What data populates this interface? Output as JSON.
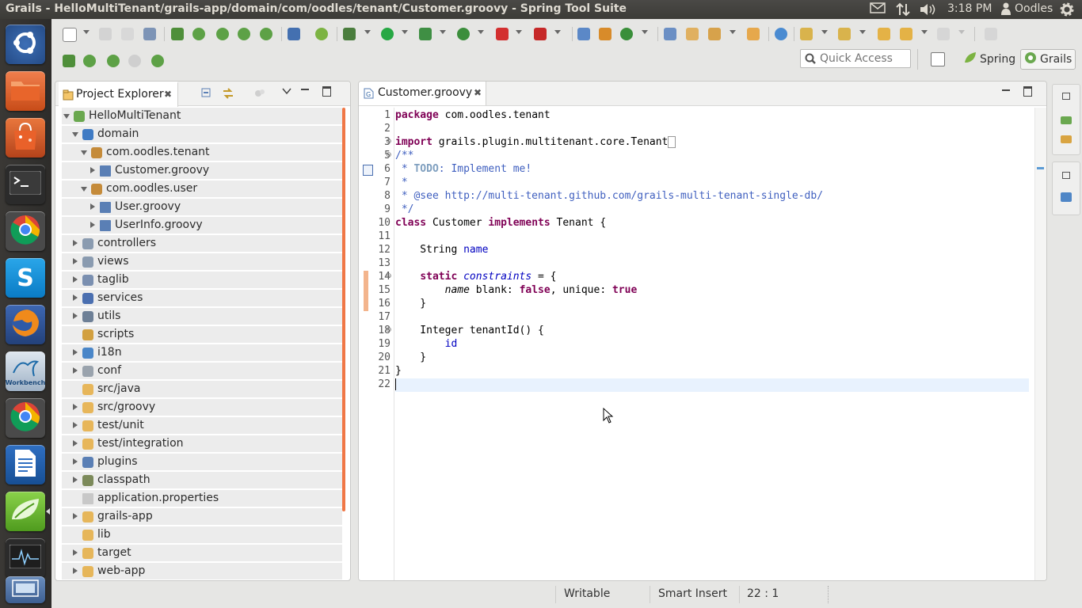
{
  "topbar": {
    "window_title": "Grails - HelloMultiTenant/grails-app/domain/com/oodles/tenant/Customer.groovy - Spring Tool Suite",
    "time": "3:18 PM",
    "user": "Oodles"
  },
  "launcher": {
    "items": [
      {
        "name": "Dash Home",
        "icon": "ubuntu-logo-icon"
      },
      {
        "name": "Files",
        "icon": "folder-icon"
      },
      {
        "name": "Ubuntu Software Center",
        "icon": "shopping-bag-icon"
      },
      {
        "name": "Terminal",
        "icon": "terminal-icon"
      },
      {
        "name": "Google Chrome",
        "icon": "chrome-icon"
      },
      {
        "name": "Skype",
        "icon": "skype-icon",
        "letter": "S"
      },
      {
        "name": "Firefox",
        "icon": "firefox-icon"
      },
      {
        "name": "MySQL Workbench",
        "icon": "mysql-workbench-icon",
        "label": "Workbench"
      },
      {
        "name": "Google Chrome",
        "icon": "chrome-icon"
      },
      {
        "name": "LibreOffice Writer",
        "icon": "writer-icon"
      },
      {
        "name": "Spring Tool Suite",
        "icon": "spring-leaf-icon"
      },
      {
        "name": "System Monitor",
        "icon": "system-monitor-icon"
      },
      {
        "name": "Workspace Switcher",
        "icon": "workspace-icon"
      }
    ]
  },
  "toolbar": {
    "quick_access_placeholder": "Quick Access",
    "perspectives": [
      "Spring",
      "Grails"
    ]
  },
  "project_explorer": {
    "tab_label": "Project Explorer",
    "tree": [
      {
        "label": "HelloMultiTenant",
        "level": 0,
        "state": "open",
        "icon": "grails-project-icon"
      },
      {
        "label": "domain",
        "level": 1,
        "state": "open",
        "icon": "domain-icon"
      },
      {
        "label": "com.oodles.tenant",
        "level": 2,
        "state": "open",
        "icon": "package-icon"
      },
      {
        "label": "Customer.groovy",
        "level": 3,
        "state": "closed",
        "icon": "groovy-file-icon"
      },
      {
        "label": "com.oodles.user",
        "level": 2,
        "state": "open",
        "icon": "package-icon"
      },
      {
        "label": "User.groovy",
        "level": 3,
        "state": "closed",
        "icon": "groovy-file-icon"
      },
      {
        "label": "UserInfo.groovy",
        "level": 3,
        "state": "closed",
        "icon": "groovy-file-icon"
      },
      {
        "label": "controllers",
        "level": 1,
        "state": "closed",
        "icon": "controllers-icon"
      },
      {
        "label": "views",
        "level": 1,
        "state": "closed",
        "icon": "views-icon"
      },
      {
        "label": "taglib",
        "level": 1,
        "state": "closed",
        "icon": "taglib-icon"
      },
      {
        "label": "services",
        "level": 1,
        "state": "closed",
        "icon": "services-icon"
      },
      {
        "label": "utils",
        "level": 1,
        "state": "closed",
        "icon": "utils-icon"
      },
      {
        "label": "scripts",
        "level": 1,
        "state": "none",
        "icon": "scripts-icon"
      },
      {
        "label": "i18n",
        "level": 1,
        "state": "closed",
        "icon": "globe-icon"
      },
      {
        "label": "conf",
        "level": 1,
        "state": "closed",
        "icon": "conf-icon"
      },
      {
        "label": "src/java",
        "level": 1,
        "state": "none",
        "icon": "source-folder-icon"
      },
      {
        "label": "src/groovy",
        "level": 1,
        "state": "closed",
        "icon": "source-folder-icon"
      },
      {
        "label": "test/unit",
        "level": 1,
        "state": "closed",
        "icon": "source-folder-icon"
      },
      {
        "label": "test/integration",
        "level": 1,
        "state": "closed",
        "icon": "source-folder-icon"
      },
      {
        "label": "plugins",
        "level": 1,
        "state": "closed",
        "icon": "plugins-icon"
      },
      {
        "label": "classpath",
        "level": 1,
        "state": "closed",
        "icon": "classpath-icon"
      },
      {
        "label": "application.properties",
        "level": 1,
        "state": "none",
        "icon": "properties-file-icon"
      },
      {
        "label": "grails-app",
        "level": 1,
        "state": "closed",
        "icon": "folder-icon"
      },
      {
        "label": "lib",
        "level": 1,
        "state": "none",
        "icon": "folder-icon"
      },
      {
        "label": "target",
        "level": 1,
        "state": "closed",
        "icon": "folder-icon"
      },
      {
        "label": "web-app",
        "level": 1,
        "state": "closed",
        "icon": "folder-icon"
      }
    ]
  },
  "editor": {
    "tab_label": "Customer.groovy",
    "lines": [
      {
        "n": "1",
        "tokens": [
          {
            "t": "package",
            "c": "kw"
          },
          {
            "t": " com.oodles.tenant",
            "c": ""
          }
        ]
      },
      {
        "n": "2",
        "tokens": []
      },
      {
        "n": "3",
        "fold": "+",
        "tokens": [
          {
            "t": "import",
            "c": "kw"
          },
          {
            "t": " grails.plugin.multitenant.core.Tenant",
            "c": ""
          },
          {
            "t": "…",
            "c": "box"
          }
        ]
      },
      {
        "n": "5",
        "fold": "-",
        "tokens": [
          {
            "t": "/**",
            "c": "cm"
          }
        ]
      },
      {
        "n": "6",
        "tokens": [
          {
            "t": " * ",
            "c": "cm"
          },
          {
            "t": "TODO",
            "c": "todo"
          },
          {
            "t": ": Implement me!",
            "c": "cm"
          }
        ]
      },
      {
        "n": "7",
        "tokens": [
          {
            "t": " *",
            "c": "cm"
          }
        ]
      },
      {
        "n": "8",
        "tokens": [
          {
            "t": " * @see http://multi-tenant.github.com/grails-multi-tenant-single-db/",
            "c": "cm"
          }
        ]
      },
      {
        "n": "9",
        "tokens": [
          {
            "t": " */",
            "c": "cm"
          }
        ]
      },
      {
        "n": "10",
        "tokens": [
          {
            "t": "class",
            "c": "kw"
          },
          {
            "t": " Customer ",
            "c": ""
          },
          {
            "t": "implements",
            "c": "kw"
          },
          {
            "t": " Tenant {",
            "c": ""
          }
        ]
      },
      {
        "n": "11",
        "tokens": []
      },
      {
        "n": "12",
        "tokens": [
          {
            "t": "    String ",
            "c": ""
          },
          {
            "t": "name",
            "c": "fld"
          }
        ]
      },
      {
        "n": "13",
        "tokens": []
      },
      {
        "n": "14",
        "fold": "-",
        "mark": true,
        "tokens": [
          {
            "t": "    ",
            "c": ""
          },
          {
            "t": "static",
            "c": "kw"
          },
          {
            "t": " ",
            "c": ""
          },
          {
            "t": "constraints",
            "c": "sf"
          },
          {
            "t": " = {",
            "c": ""
          }
        ]
      },
      {
        "n": "15",
        "mark": true,
        "tokens": [
          {
            "t": "        ",
            "c": ""
          },
          {
            "t": "name",
            "c": "ivar"
          },
          {
            "t": " blank: ",
            "c": ""
          },
          {
            "t": "false",
            "c": "kw"
          },
          {
            "t": ", unique: ",
            "c": ""
          },
          {
            "t": "true",
            "c": "kw"
          }
        ]
      },
      {
        "n": "16",
        "mark": true,
        "tokens": [
          {
            "t": "    }",
            "c": ""
          }
        ]
      },
      {
        "n": "17",
        "tokens": []
      },
      {
        "n": "18",
        "fold": "-",
        "tokens": [
          {
            "t": "    Integer tenantId() {",
            "c": ""
          }
        ]
      },
      {
        "n": "19",
        "tokens": [
          {
            "t": "        ",
            "c": ""
          },
          {
            "t": "id",
            "c": "fld"
          }
        ]
      },
      {
        "n": "20",
        "tokens": [
          {
            "t": "    }",
            "c": ""
          }
        ]
      },
      {
        "n": "21",
        "tokens": [
          {
            "t": "}",
            "c": ""
          }
        ]
      },
      {
        "n": "22",
        "current": true,
        "tokens": []
      }
    ]
  },
  "status": {
    "writable": "Writable",
    "insert_mode": "Smart Insert",
    "position": "22 : 1"
  }
}
